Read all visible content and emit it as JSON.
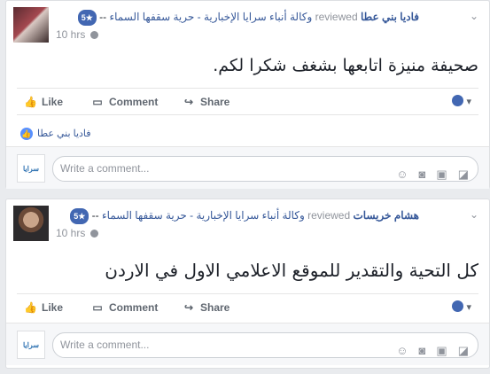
{
  "posts": [
    {
      "author": "فاديا بني عطا",
      "action": "reviewed",
      "page": "وكالة أنباء سرايا الإخبارية - حرية سقفها السماء",
      "dash": "--",
      "stars": "5★",
      "time": "10 hrs",
      "text": "صحيفة منيزة اتابعها بشغف شكرا لكم.",
      "likes_by": "فاديا بني عطا",
      "actions": {
        "like": "Like",
        "comment": "Comment",
        "share": "Share"
      },
      "comment_placeholder": "Write a comment..."
    },
    {
      "author": "هشام خريسات",
      "action": "reviewed",
      "page": "وكالة أنباء سرايا الإخبارية - حرية سقفها السماء",
      "dash": "--",
      "stars": "5★",
      "time": "10 hrs",
      "text": "كل التحية والتقدير للموقع الاعلامي الاول في الاردن",
      "actions": {
        "like": "Like",
        "comment": "Comment",
        "share": "Share"
      },
      "comment_placeholder": "Write a comment..."
    }
  ],
  "commenter_logo_text": "سرايا",
  "icons": [
    "chevron-down-icon",
    "globe-icon",
    "like-icon",
    "comment-icon",
    "share-icon",
    "smiley-icon",
    "camera-icon",
    "gif-icon",
    "sticker-icon"
  ]
}
